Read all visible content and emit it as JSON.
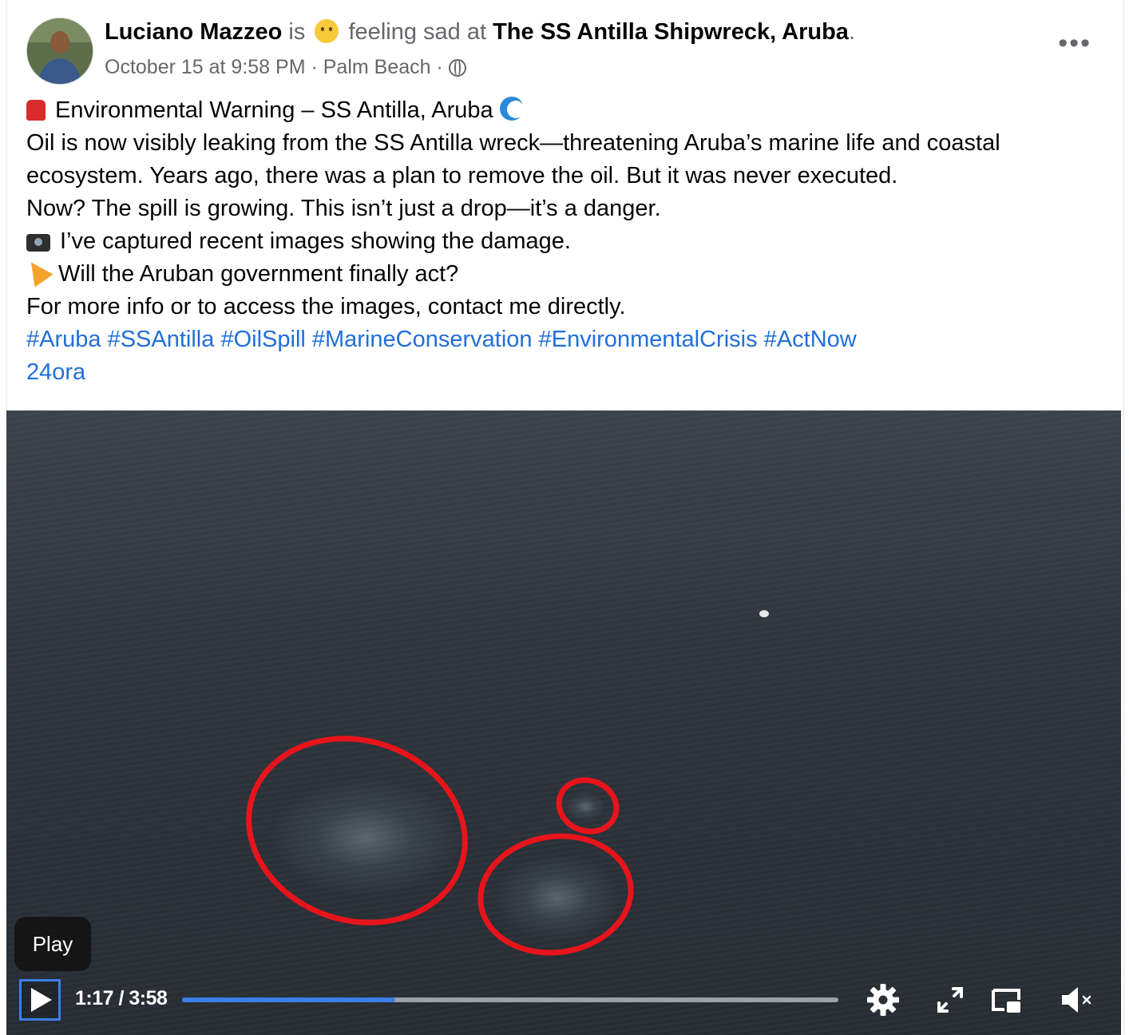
{
  "post": {
    "author": "Luciano Mazzeo",
    "is_word": "is",
    "feeling": "feeling sad",
    "at_word": "at",
    "location": "The SS Antilla Shipwreck, Aruba",
    "period": ".",
    "date": "October 15 at 9:58 PM",
    "separator1": " · ",
    "place": "Palm Beach",
    "separator2": " · ",
    "more_label": "•••",
    "lines": {
      "l1": "Environmental Warning – SS Antilla, Aruba",
      "l2": "Oil is now visibly leaking from the SS Antilla wreck—threatening Aruba’s marine life and coastal",
      "l3": "ecosystem. Years ago, there was a plan to remove the oil. But it was never executed.",
      "l4": "Now? The spill is growing. This isn’t just a drop—it’s a danger.",
      "l5": "I’ve captured recent images showing the damage.",
      "l6": "Will the Aruban government finally act?",
      "l7": "For more info or to access the images, contact me directly."
    },
    "hashtags": [
      "#Aruba",
      "#SSAntilla",
      "#OilSpill",
      "#MarineConservation",
      "#EnvironmentalCrisis",
      "#ActNow"
    ],
    "hashtag_extra": "24ora"
  },
  "video": {
    "tooltip": "Play",
    "current_time": "1:17",
    "duration": "3:58",
    "time_display": "1:17 / 3:58",
    "progress": 0.325
  },
  "icons": {
    "warning": "red-siren-icon",
    "wave": "wave-icon",
    "camera": "camera-icon",
    "party": "party-popper-icon",
    "feeling": "sad-face-icon",
    "globe": "globe-icon"
  },
  "colors": {
    "link": "#216fdb",
    "annotation": "#e8141c",
    "progress": "#3b7ee8"
  }
}
